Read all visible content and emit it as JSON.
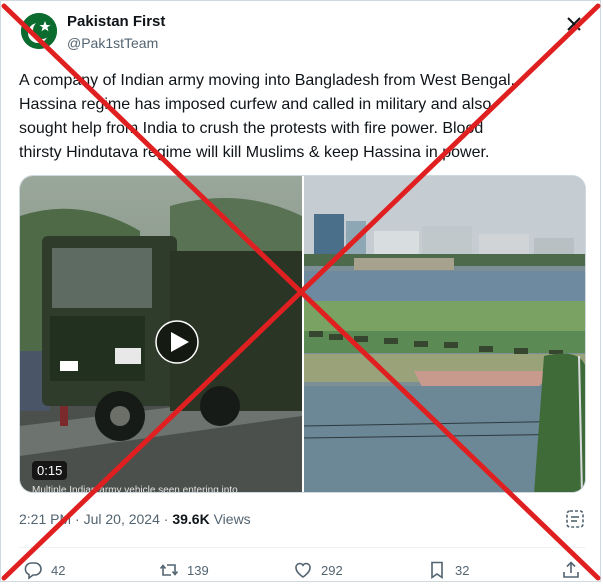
{
  "author": {
    "display_name": "Pakistan First",
    "handle": "@Pak1stTeam"
  },
  "tweet": {
    "text": "A company of Indian army moving into Bangladesh from West Bengal.\nHassina regime has imposed curfew and called in military and also\nsought help from India to crush the protests with fire power. Blood\nthirsty Hindutava regime will kill Muslims & keep Hassina in power."
  },
  "media": {
    "duration": "0:15",
    "caption": "Multiple Indian army vehicle seen entering into"
  },
  "meta": {
    "time": "2:21 PM",
    "separator": "·",
    "date": "Jul 20, 2024",
    "views_count": "39.6K",
    "views_label": "Views"
  },
  "actions": {
    "replies": "42",
    "reposts": "139",
    "likes": "292",
    "bookmarks": "32"
  },
  "colors": {
    "cross": "#e02020",
    "avatar": "#0c6b2e"
  },
  "icons": [
    "close-icon",
    "play-icon",
    "grok-icon",
    "reply-icon",
    "repost-icon",
    "like-icon",
    "bookmark-icon",
    "share-icon"
  ]
}
